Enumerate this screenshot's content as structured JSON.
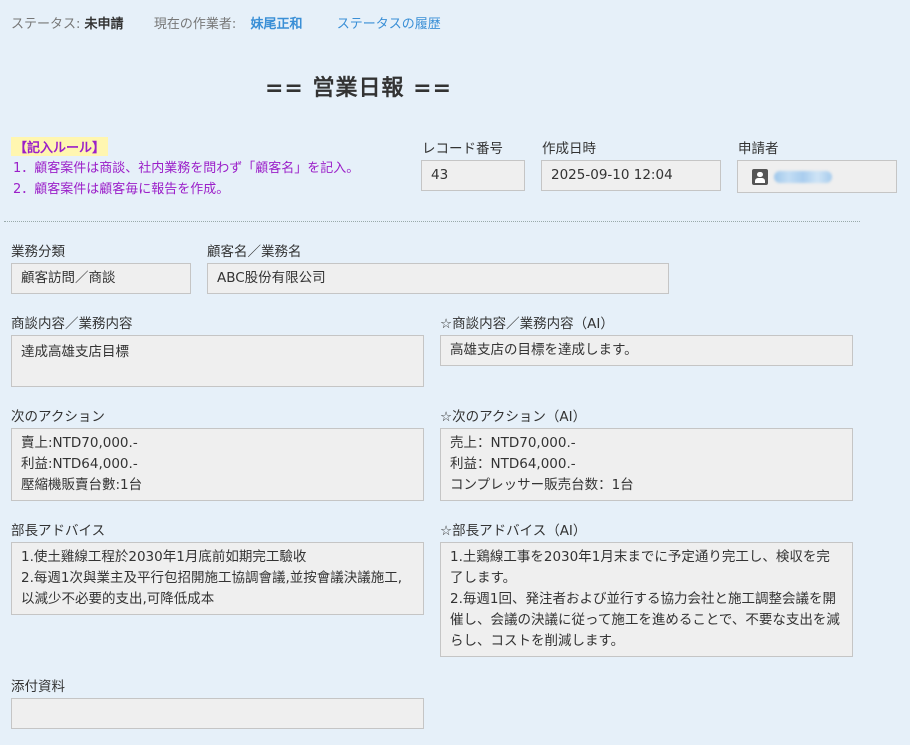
{
  "status": {
    "status_label": "ステータス:",
    "status_value": "未申請",
    "worker_label": "現在の作業者:",
    "worker_value": "妹尾正和",
    "history_link": "ステータスの履歴"
  },
  "title": "== 営業日報 ==",
  "rules": {
    "heading": "【記入ルール】",
    "lines": [
      "1．顧客案件は商談、社内業務を問わず「顧客名」を記入。",
      "2．顧客案件は顧客毎に報告を作成。"
    ]
  },
  "header_fields": {
    "record_number": {
      "label": "レコード番号",
      "value": "43"
    },
    "created_at": {
      "label": "作成日時",
      "value": "2025-09-10 12:04"
    },
    "applicant": {
      "label": "申請者",
      "icon": "user-icon"
    }
  },
  "fields": {
    "business_category": {
      "label": "業務分類",
      "value": "顧客訪問／商談"
    },
    "customer_name": {
      "label": "顧客名／業務名",
      "value": "ABC股份有限公司"
    },
    "meeting_content": {
      "label": "商談内容／業務内容",
      "value": "達成高雄支店目標"
    },
    "meeting_content_ai": {
      "label": "☆商談内容／業務内容（AI）",
      "value": "高雄支店の目標を達成します。"
    },
    "next_action": {
      "label": "次のアクション",
      "value": "賣上:NTD70,000.-\n利益:NTD64,000.-\n壓縮機販賣台數:1台"
    },
    "next_action_ai": {
      "label": "☆次のアクション（AI）",
      "value": "売上：NTD70,000.-\n利益：NTD64,000.-\nコンプレッサー販売台数：1台"
    },
    "manager_advice": {
      "label": "部長アドバイス",
      "value": "1.使土雞線工程於2030年1月底前如期完工驗收\n2.每週1次與業主及平行包招開施工協調會議,並按會議決議施工,以減少不必要的支出,可降低成本"
    },
    "manager_advice_ai": {
      "label": "☆部長アドバイス（AI）",
      "value": "1.土鶏線工事を2030年1月末までに予定通り完工し、検収を完了します。\n2.毎週1回、発注者および並行する協力会社と施工調整会議を開催し、会議の決議に従って施工を進めることで、不要な支出を減らし、コストを削減します。"
    },
    "attachments": {
      "label": "添付資料",
      "value": ""
    }
  },
  "colors": {
    "background": "#e6f0f9",
    "link": "#3a8fd6",
    "rule_text": "#9b1fc9",
    "rule_highlight": "#fff6b0"
  }
}
